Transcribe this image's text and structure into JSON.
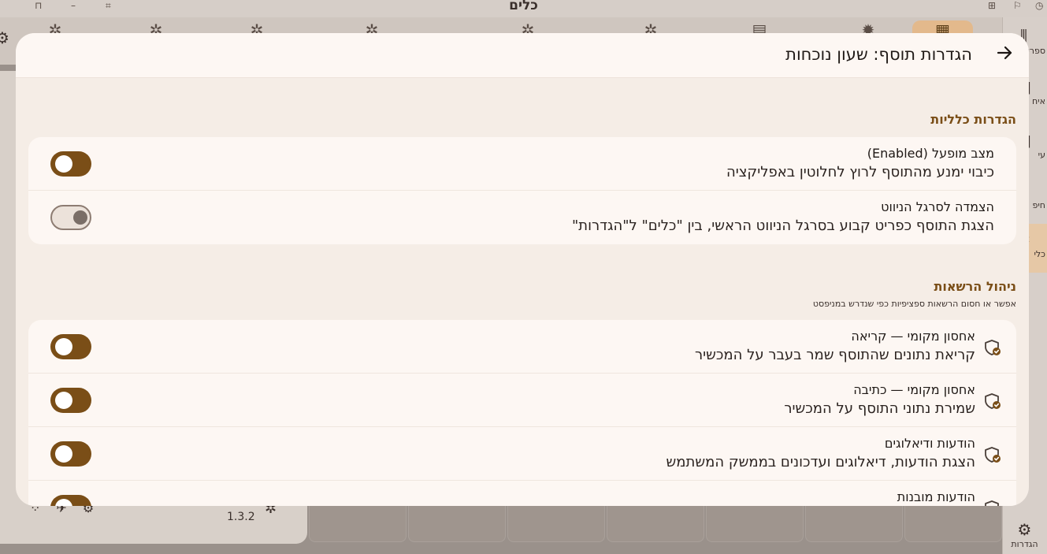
{
  "app": {
    "title": "כלים",
    "version": "1.3.2"
  },
  "rail": {
    "items": [
      {
        "label": "ספרי",
        "icon": "library-icon"
      },
      {
        "label": "איח",
        "icon": "contact-card-icon"
      },
      {
        "label": "עי",
        "icon": "book-icon"
      },
      {
        "label": "חיפ",
        "icon": "search-icon"
      },
      {
        "label": "כלי",
        "icon": "puzzle-icon"
      }
    ],
    "settings_label": "הגדרות"
  },
  "modal": {
    "title": "הגדרות תוסף: שעון נוכחות",
    "back_icon": "arrow-right-icon",
    "general": {
      "heading": "הגדרות כלליות",
      "rows": [
        {
          "title": "מצב מופעל (Enabled)",
          "desc": "כיבוי ימנע מהתוסף לרוץ לחלוטין באפליקציה",
          "on": true
        },
        {
          "title": "הצמדה לסרגל הניווט",
          "desc": "הצגת התוסף כפריט קבוע בסרגל הניווט הראשי, בין \"כלים\" ל\"הגדרות\"",
          "on": false
        }
      ]
    },
    "permissions": {
      "heading": "ניהול הרשאות",
      "subtitle": "אפשר או חסום הרשאות ספציפיות כפי שנדרש במניפסט",
      "rows": [
        {
          "title": "אחסון מקומי — קריאה",
          "desc": "קריאת נתונים שהתוסף שמר בעבר על המכשיר",
          "on": true,
          "icon": "shield-check-icon"
        },
        {
          "title": "אחסון מקומי — כתיבה",
          "desc": "שמירת נתוני התוסף על המכשיר",
          "on": true,
          "icon": "shield-check-icon"
        },
        {
          "title": "הודעות ודיאלוגים",
          "desc": "הצגת הודעות, דיאלוגים ועדכונים בממשק המשתמש",
          "on": true,
          "icon": "shield-check-icon"
        },
        {
          "title": "הודעות מובנות",
          "desc": "",
          "on": true,
          "icon": "shield-check-icon"
        }
      ]
    }
  },
  "colors": {
    "accent": "#7a4e17",
    "modal_bg": "#f5ede6",
    "card_bg": "#fdf7f3"
  }
}
